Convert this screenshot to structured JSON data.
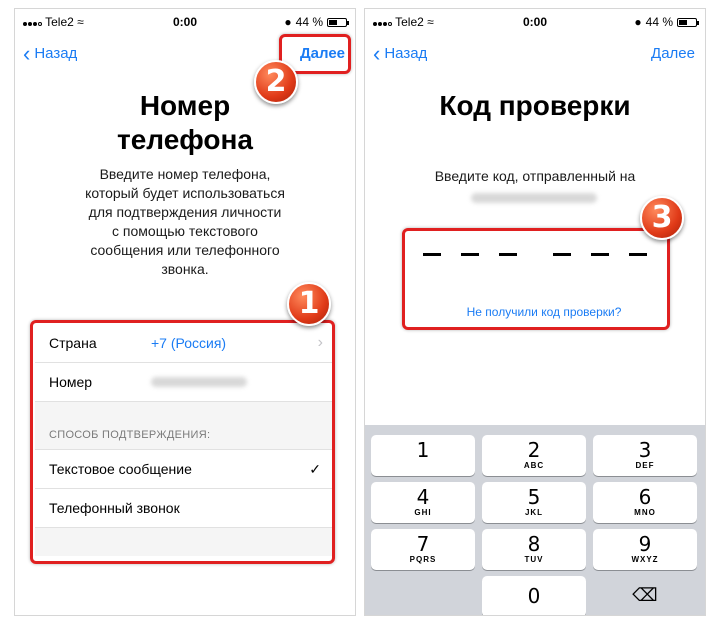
{
  "status": {
    "carrier": "Tele2",
    "time": "0:00",
    "battery": "44 %",
    "battery_level": 0.44
  },
  "left": {
    "back_label": "Назад",
    "next_label": "Далее",
    "title_line1": "Номер",
    "title_line2": "телефона",
    "description": [
      "Введите номер телефона,",
      "который будет использоваться",
      "для подтверждения личности",
      "с помощью текстового",
      "сообщения или телефонного",
      "звонка."
    ],
    "country_label": "Страна",
    "country_value": "+7 (Россия)",
    "number_label": "Номер",
    "method_header": "СПОСОБ ПОДТВЕРЖДЕНИЯ:",
    "option_sms": "Текстовое сообщение",
    "option_call": "Телефонный звонок"
  },
  "right": {
    "back_label": "Назад",
    "next_label": "Далее",
    "title": "Код проверки",
    "description": "Введите код, отправленный на",
    "no_code_link": "Не получили код проверки?"
  },
  "badges": [
    "1",
    "2",
    "3"
  ],
  "keypad": [
    {
      "num": "1",
      "letters": ""
    },
    {
      "num": "2",
      "letters": "ABC"
    },
    {
      "num": "3",
      "letters": "DEF"
    },
    {
      "num": "4",
      "letters": "GHI"
    },
    {
      "num": "5",
      "letters": "JKL"
    },
    {
      "num": "6",
      "letters": "MNO"
    },
    {
      "num": "7",
      "letters": "PQRS"
    },
    {
      "num": "8",
      "letters": "TUV"
    },
    {
      "num": "9",
      "letters": "WXYZ"
    },
    {
      "num": "0",
      "letters": ""
    }
  ],
  "icons": {
    "delete": "backspace-icon",
    "check": "checkmark-icon",
    "chevron": "chevron-right-icon"
  },
  "colors": {
    "accent": "#1b7cf4",
    "highlight": "#e02020",
    "keypad_bg": "#d1d4da"
  }
}
